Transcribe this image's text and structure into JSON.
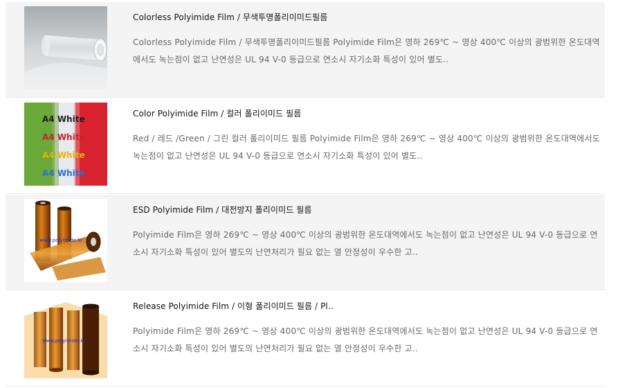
{
  "products": [
    {
      "title": "Colorless Polyimide Film / 무색투명폴리이미드필름",
      "description": "Colorless Polyimide Film / 무색투명폴리이미드필름 Polyimide Film은 영하 269℃ ~ 영상 400℃ 이상의 광범위한 온도대역에서도 녹는점이 없고 난연성은 UL 94 V-0 등급으로 연소시 자기소화 특성이 있어 별도..",
      "image": "clear-film-roll"
    },
    {
      "title": "Color Polyimide Film / 컬러 폴리이미드 필름",
      "description": "Red / 레드 /Green / 그린 컬러 폴리이미드 필름 Polyimide Film은 영하 269℃ ~ 영상 400℃ 이상의 광범위한 온도대역에서도 녹는점이 없고 난연성은 UL 94 V-0 등급으로 연소시 자기소화 특성이 있어 별도..",
      "image": "color-film-samples",
      "image_text": [
        "A4 White",
        "A4 White",
        "A4 White",
        "A4 White"
      ]
    },
    {
      "title": "ESD Polyimide Film / 대전방지 폴리이미드 필름",
      "description": "Polyimide Film은 영하 269℃ ~ 영상 400℃ 이상의 광범위한 온도대역에서도 녹는점이 없고 난연성은 UL 94 V-0 등급으로 연소시 자기소화 특성이 있어 별도의 난연처리가 필요 없는 열 안정성이 우수한 고..",
      "image": "amber-film-rolls",
      "watermark": "www.polyimide.kr"
    },
    {
      "title": "Release Polyimide Film / 이형 폴리이미드 필름 / Pl..",
      "description": "Polyimide Film은 영하 269℃ ~ 영상 400℃ 이상의 광범위한 온도대역에서도 녹는점이 없고 난연성은 UL 94 V-0 등급으로 연소시 자기소화 특성이 있어 별도의 난연처리가 필요 없는 열 안정성이 우수한 고..",
      "image": "amber-film-rolls",
      "watermark": "www.polyimide.kr"
    }
  ]
}
